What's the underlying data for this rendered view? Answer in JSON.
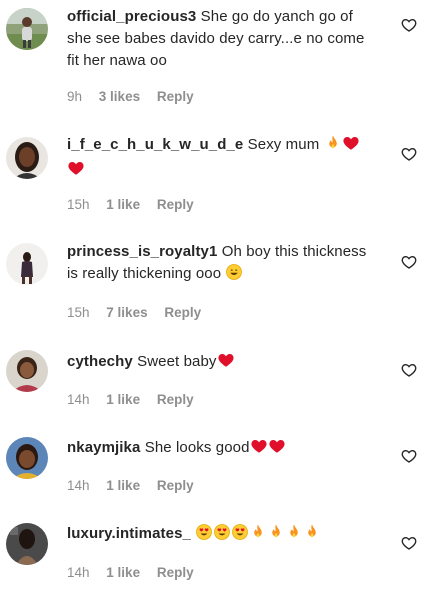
{
  "comments": [
    {
      "username": "official_precious3",
      "text": "She go do yanch go of she see babes davido dey carry...e no come fit her nawa oo",
      "time": "9h",
      "likes": "3 likes",
      "reply": "Reply",
      "emojis": [],
      "avatar_icon": "user-avatar-outdoor-photo"
    },
    {
      "username": "i_f_e_c_h_u_k_w_u_d_e",
      "text": "Sexy mum",
      "time": "15h",
      "likes": "1 like",
      "reply": "Reply",
      "emojis": [
        "fire",
        "red-heart",
        "red-heart"
      ],
      "avatar_icon": "user-avatar-portrait"
    },
    {
      "username": "princess_is_royalty1",
      "text": "Oh boy this thickness is really thickening ooo",
      "time": "15h",
      "likes": "7 likes",
      "reply": "Reply",
      "emojis": [
        "grinning-face"
      ],
      "avatar_icon": "user-avatar-standing"
    },
    {
      "username": "cythechy",
      "text": "Sweet baby",
      "time": "14h",
      "likes": "1 like",
      "reply": "Reply",
      "emojis": [
        "red-heart"
      ],
      "avatar_icon": "user-avatar-portrait"
    },
    {
      "username": "nkaymjika",
      "text": "She looks good",
      "time": "14h",
      "likes": "1 like",
      "reply": "Reply",
      "emojis": [
        "red-heart",
        "red-heart"
      ],
      "avatar_icon": "user-avatar-portrait"
    },
    {
      "username": "luxury.intimates_",
      "text": "",
      "time": "14h",
      "likes": "1 like",
      "reply": "Reply",
      "emojis": [
        "heart-eyes",
        "heart-eyes",
        "heart-eyes",
        "fire",
        "fire",
        "fire",
        "fire"
      ],
      "avatar_icon": "user-avatar-dark"
    }
  ],
  "like_icon": "heart-outline-icon",
  "colors": {
    "text": "#262626",
    "meta": "#8e8e8e",
    "heart": "#e0102b",
    "fire": "#f7931e"
  }
}
